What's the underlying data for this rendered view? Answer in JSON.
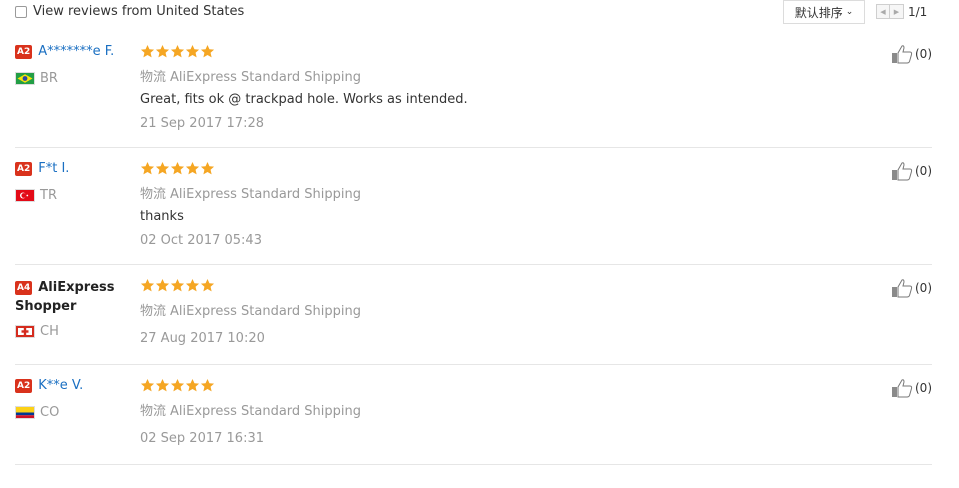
{
  "toolbar": {
    "filter_label": "View reviews from United States",
    "sort_label": "默认排序",
    "page_indicator": "1/1"
  },
  "reviews": [
    {
      "badge": "A2",
      "name": "A*******e F.",
      "name_style": "link",
      "country": "BR",
      "flag": "brazil-flag",
      "stars": 5,
      "shipping_key": "物流",
      "shipping": "AliExpress Standard Shipping",
      "text": "Great, fits ok @ trackpad hole. Works as intended.",
      "date": "21 Sep 2017 17:28",
      "helpful": "(0)"
    },
    {
      "badge": "A2",
      "name": "F*t I.",
      "name_style": "link",
      "country": "TR",
      "flag": "turkey-flag",
      "stars": 5,
      "shipping_key": "物流",
      "shipping": "AliExpress Standard Shipping",
      "text": "thanks",
      "date": "02 Oct 2017 05:43",
      "helpful": "(0)"
    },
    {
      "badge": "A4",
      "name": "AliExpress Shopper",
      "name_style": "plain",
      "country": "CH",
      "flag": "switzerland-flag",
      "stars": 5,
      "shipping_key": "物流",
      "shipping": "AliExpress Standard Shipping",
      "text": "",
      "date": "27 Aug 2017 10:20",
      "helpful": "(0)"
    },
    {
      "badge": "A2",
      "name": "K**e V.",
      "name_style": "link",
      "country": "CO",
      "flag": "colombia-flag",
      "stars": 5,
      "shipping_key": "物流",
      "shipping": "AliExpress Standard Shipping",
      "text": "",
      "date": "02 Sep 2017 16:31",
      "helpful": "(0)"
    }
  ],
  "colors": {
    "link": "#1a6fc2",
    "badge": "#d9321c",
    "star": "#f5a623",
    "muted": "#999999"
  }
}
